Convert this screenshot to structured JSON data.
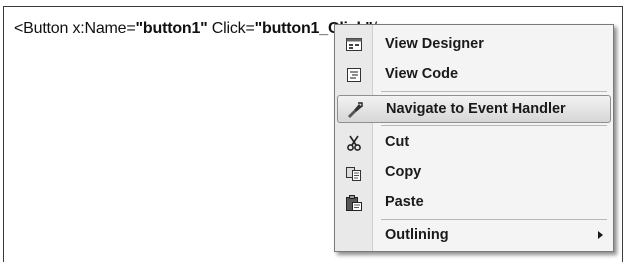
{
  "editor": {
    "code_prefix": "<Button x:Name=",
    "name_value": "\"button1\"",
    "click_attr": " Click=",
    "click_value": "\"button1_Click\"",
    "code_suffix": "/>"
  },
  "context_menu": {
    "items": [
      {
        "label": "View Designer",
        "icon": "view-designer-icon"
      },
      {
        "label": "View Code",
        "icon": "view-code-icon"
      },
      {
        "label": "Navigate to Event Handler",
        "icon": "navigate-event-handler-icon",
        "highlighted": true
      },
      {
        "label": "Cut",
        "icon": "scissors-icon"
      },
      {
        "label": "Copy",
        "icon": "copy-icon"
      },
      {
        "label": "Paste",
        "icon": "paste-icon"
      },
      {
        "label": "Outlining",
        "icon": "",
        "submenu": true
      }
    ]
  }
}
